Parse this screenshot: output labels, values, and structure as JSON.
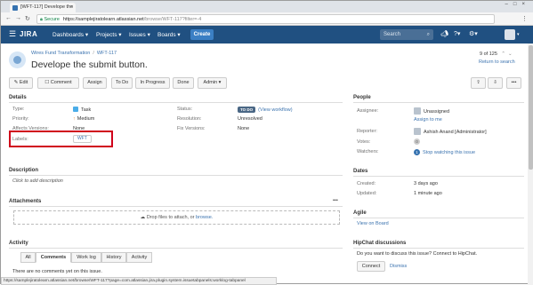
{
  "browser": {
    "tab_title": "[WFT-117] Develope the",
    "url_secure": "Secure",
    "url_host": "https://samplejiratolearn.atlassian.net",
    "url_path": "/browse/WFT-117?filter=-4",
    "status_url": "https://samplejiratolearn.atlassian.net/browse/WFT-117?page=com.atlassian.jira.plugin.system.issuetabpanels:worklog-tabpanel"
  },
  "header": {
    "logo": "JIRA",
    "nav": [
      "Dashboards ▾",
      "Projects ▾",
      "Issues ▾",
      "Boards ▾"
    ],
    "create": "Create",
    "search_placeholder": "Search"
  },
  "issue": {
    "project": "Wires Fund Transformation",
    "key": "WFT-117",
    "title": "Develope the submit button.",
    "pager": "9 of 125",
    "return": "Return to search"
  },
  "toolbar": {
    "edit": "✎ Edit",
    "comment": "☐ Comment",
    "assign": "Assign",
    "todo": "To Do",
    "in_progress": "In Progress",
    "done": "Done",
    "admin": "Admin ▾"
  },
  "details": {
    "heading": "Details",
    "type_label": "Type:",
    "type_value": "Task",
    "priority_label": "Priority:",
    "priority_value": "Medium",
    "affects_label": "Affects Versions:",
    "affects_value": "None",
    "labels_label": "Labels:",
    "labels_value": "WFT",
    "status_label": "Status:",
    "status_value": "TO DO",
    "view_workflow": "(View workflow)",
    "resolution_label": "Resolution:",
    "resolution_value": "Unresolved",
    "fixver_label": "Fix Versions:",
    "fixver_value": "None"
  },
  "people": {
    "heading": "People",
    "assignee_label": "Assignee:",
    "assignee_value": "Unassigned",
    "assign_to_me": "Assign to me",
    "reporter_label": "Reporter:",
    "reporter_value": "Ashish Anand [Administrator]",
    "votes_label": "Votes:",
    "votes_value": "0",
    "watchers_label": "Watchers:",
    "watchers_count": "1",
    "watchers_value": "Stop watching this issue"
  },
  "dates": {
    "heading": "Dates",
    "created_label": "Created:",
    "created_value": "3 days ago",
    "updated_label": "Updated:",
    "updated_value": "1 minute ago"
  },
  "agile": {
    "heading": "Agile",
    "view_board": "View on Board"
  },
  "hipchat": {
    "heading": "HipChat discussions",
    "prompt": "Do you want to discuss this issue? Connect to HipChat.",
    "connect": "Connect",
    "dismiss": "Dismiss"
  },
  "description": {
    "heading": "Description",
    "placeholder": "Click to add description"
  },
  "attachments": {
    "heading": "Attachments",
    "drop_text": "Drop files to attach, or ",
    "browse": "browse."
  },
  "activity": {
    "heading": "Activity",
    "tabs": [
      "All",
      "Comments",
      "Work log",
      "History",
      "Activity"
    ],
    "empty": "There are no comments yet on this issue."
  },
  "colors": {
    "header": "#205081",
    "link": "#3b73af",
    "highlight": "#d0021b"
  }
}
